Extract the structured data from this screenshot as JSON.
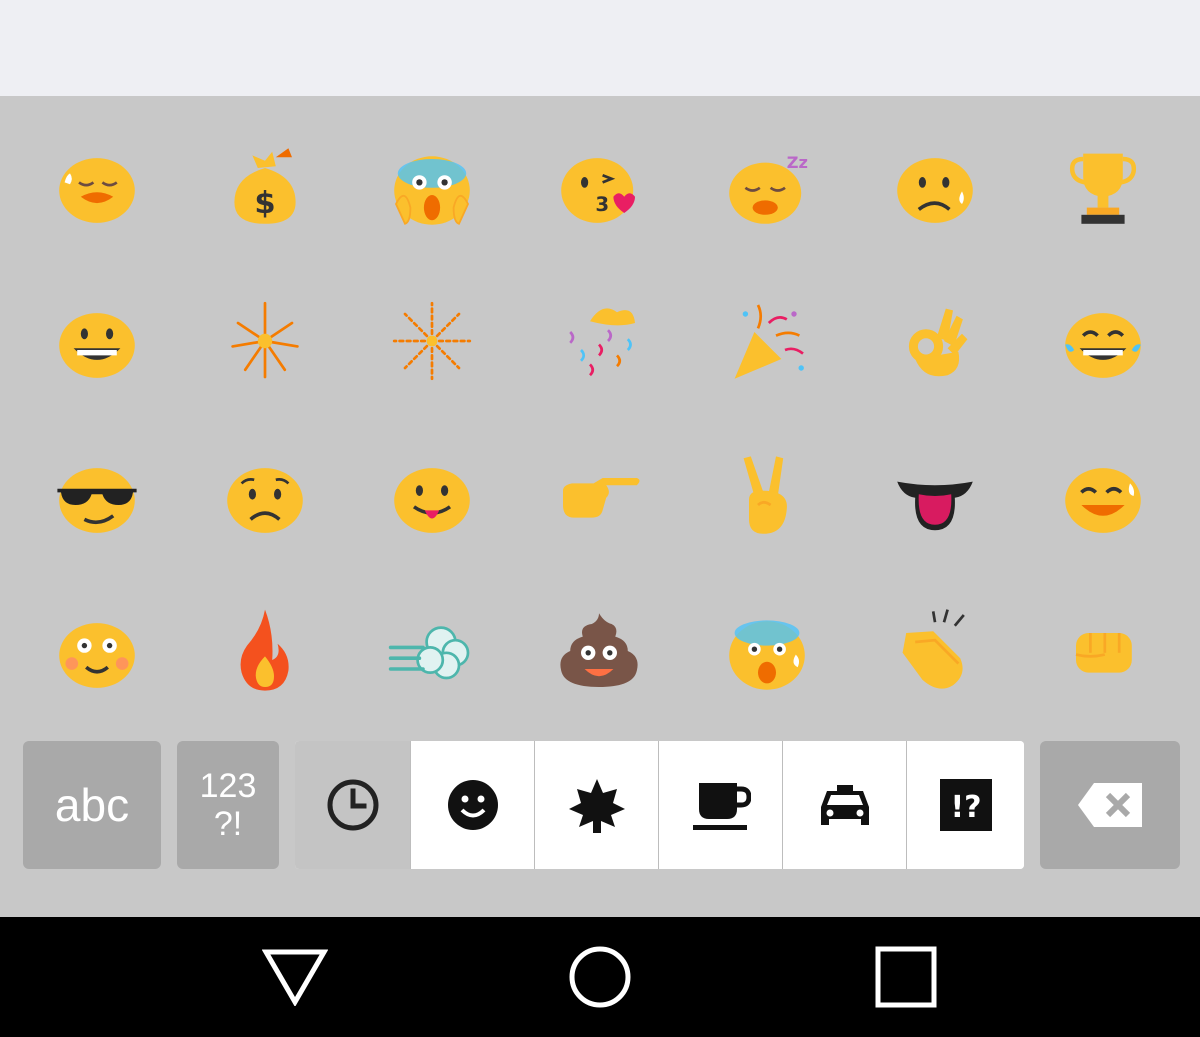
{
  "keyboard": {
    "emoji_rows": [
      [
        "weary-face",
        "money-bag",
        "screaming-face",
        "kissing-face-heart",
        "sleeping-face",
        "crying-face",
        "trophy"
      ],
      [
        "grinning-face",
        "sparkler",
        "fireworks",
        "confetti-ball",
        "party-popper",
        "ok-hand",
        "tears-of-joy-face"
      ],
      [
        "sunglasses-face",
        "frowning-face",
        "tongue-out-face",
        "pointing-right-hand",
        "victory-hand",
        "tongue",
        "sweat-smile-face"
      ],
      [
        "blushing-face",
        "fire",
        "dash-cloud",
        "pile-of-poo",
        "fearful-face",
        "clapping-hands",
        "fist"
      ]
    ],
    "abc_label": "abc",
    "num_label_top": "123",
    "num_label_bottom": "?!",
    "tabs": [
      {
        "name": "recent",
        "icon": "clock-icon",
        "active": true
      },
      {
        "name": "smileys",
        "icon": "smiley-icon",
        "active": false
      },
      {
        "name": "nature",
        "icon": "leaf-icon",
        "active": false
      },
      {
        "name": "food",
        "icon": "coffee-icon",
        "active": false
      },
      {
        "name": "travel",
        "icon": "car-icon",
        "active": false
      },
      {
        "name": "symbols",
        "icon": "symbols-icon",
        "active": false
      }
    ],
    "symbols_tab_label": "!?",
    "delete_icon": "backspace-icon"
  },
  "nav_bar": {
    "back_icon": "back-triangle-icon",
    "home_icon": "home-circle-icon",
    "recents_icon": "recents-square-icon"
  },
  "colors": {
    "keyboard_bg": "#c8c8c8",
    "key_bg": "#a9a9a9",
    "emoji_yellow": "#fbc02d",
    "emoji_orange": "#f57c00"
  }
}
